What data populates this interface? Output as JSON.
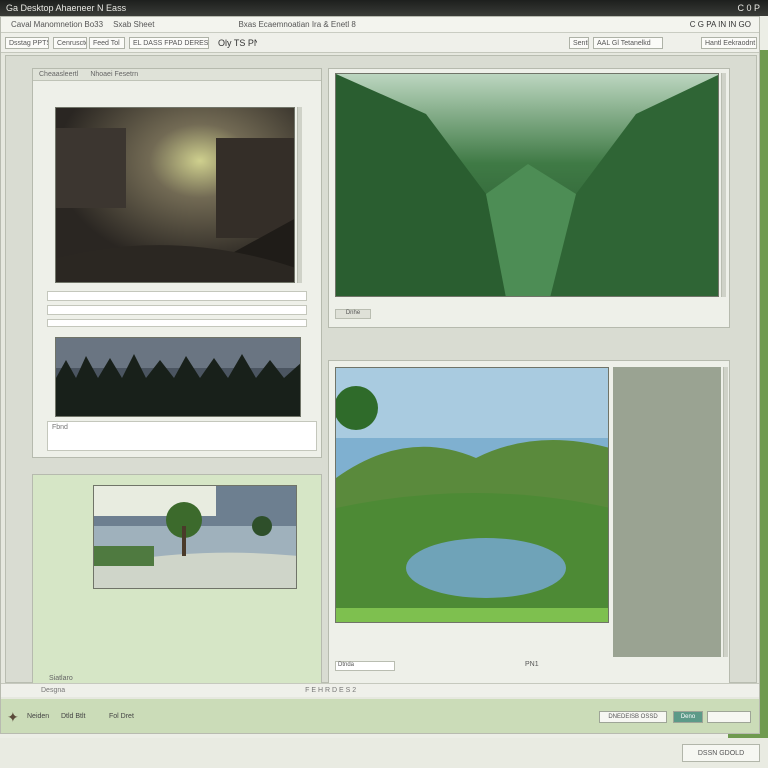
{
  "titlebar": {
    "title": "Ga Desktop Ahaeneer N Eass",
    "right": "C 0 P"
  },
  "menubar": {
    "items": [
      "Caval Manomnetion Bo33",
      "Sxab Sheet",
      "Bxas Ecaemnoatian Ira & Enetl 8"
    ],
    "right": "C G PA IN IN GO"
  },
  "toolbar": {
    "items": [
      "Dsstag PPTS",
      "Cenrusctes",
      "Feed Tol",
      "EL DASS FPAD DERESEND ELELORE",
      "Oly TS PNl",
      "Sentlx",
      "AAL Gl Tetanelkd",
      "Hantl Eekraodnt"
    ]
  },
  "panes": {
    "left_top_tabs": [
      "Cheaasleertl",
      "Nhoaei Fesetrn"
    ],
    "caption_1": "Fbnd",
    "caption_2": "Dnhe",
    "left_bottom_label": "Siatlaro",
    "right_label": "PN1",
    "right_status": "Dtnda"
  },
  "statusbar": {
    "left": "Desgna",
    "center": "F E H R D E S 2"
  },
  "bottombar": {
    "logo_label": "Neiden",
    "items": [
      "Dtld Btlt",
      "Fol Dret"
    ],
    "btn_1": "DNEDEISB OSSD",
    "btn_2": "Deno"
  },
  "ok_button": "DSSN GDOLD",
  "colors": {
    "accent": "#6f9a4f",
    "panel": "#eef0e9"
  }
}
